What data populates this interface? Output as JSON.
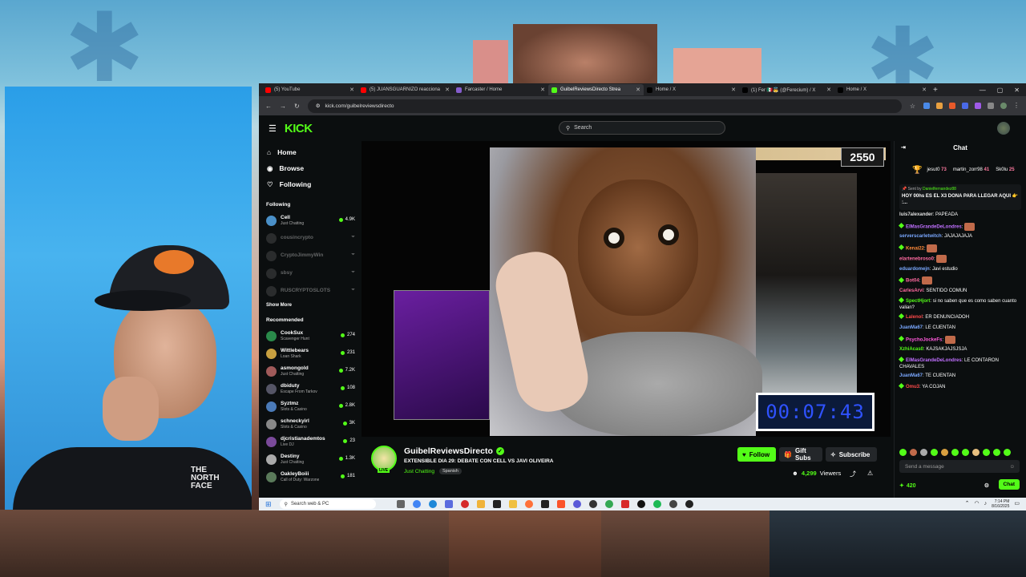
{
  "browser": {
    "tabs": [
      {
        "label": "(5) YouTube",
        "color": "#ff0000",
        "active": false
      },
      {
        "label": "(5) JUANSGUARNIZO reacciona",
        "color": "#ff0000",
        "active": false
      },
      {
        "label": "Farcaster / Home",
        "color": "#855dcd",
        "active": false
      },
      {
        "label": "GuibelReviewsDirecto Strea",
        "color": "#53fc18",
        "active": true
      },
      {
        "label": "Home / X",
        "color": "#000000",
        "active": false
      },
      {
        "label": "(1) Fer 🇲🇽👼 (@Ferecium) / X",
        "color": "#000000",
        "active": false
      },
      {
        "label": "Home / X",
        "color": "#000000",
        "active": false
      }
    ],
    "url": "kick.com/guibelreviewsdirecto"
  },
  "kick": {
    "logo": "KICK",
    "search_placeholder": "Search",
    "nav": [
      {
        "label": "Home",
        "icon": "home-icon",
        "glyph": "⌂"
      },
      {
        "label": "Browse",
        "icon": "compass-icon",
        "glyph": "◉"
      },
      {
        "label": "Following",
        "icon": "heart-icon",
        "glyph": "♡"
      }
    ],
    "following_title": "Following",
    "following": [
      {
        "name": "Cell",
        "category": "Just Chatting",
        "viewers": "4.9K",
        "online": true,
        "color": "#4a90c8"
      },
      {
        "name": "cousincrypto",
        "category": "",
        "viewers": "",
        "online": false,
        "color": "#666"
      },
      {
        "name": "CryptoJimmyWin",
        "category": "",
        "viewers": "",
        "online": false,
        "color": "#666"
      },
      {
        "name": "sbsy",
        "category": "",
        "viewers": "",
        "online": false,
        "color": "#666"
      },
      {
        "name": "RUSCRYPTOSLOTS",
        "category": "",
        "viewers": "",
        "online": false,
        "color": "#666"
      }
    ],
    "show_more": "Show More",
    "recommended_title": "Recommended",
    "recommended": [
      {
        "name": "CookSux",
        "category": "Scavenger Hunt",
        "viewers": "274",
        "color": "#2a8a4a"
      },
      {
        "name": "Wittlebears",
        "category": "Loan Shark",
        "viewers": "231",
        "color": "#c8a040"
      },
      {
        "name": "asmongold",
        "category": "Just Chatting",
        "viewers": "7.2K",
        "color": "#a05a5a"
      },
      {
        "name": "dbiduty",
        "category": "Escape From Tarkov",
        "viewers": "108",
        "color": "#556"
      },
      {
        "name": "Syztmz",
        "category": "Slots & Casino",
        "viewers": "2.8K",
        "color": "#4a7ab8"
      },
      {
        "name": "schneckyirl",
        "category": "Slots & Casino",
        "viewers": "3K",
        "color": "#888"
      },
      {
        "name": "djcristianademtos",
        "category": "Live DJ",
        "viewers": "23",
        "color": "#7a4a9a"
      },
      {
        "name": "Destiny",
        "category": "Just Chatting",
        "viewers": "1.3K",
        "color": "#aaa"
      },
      {
        "name": "OakleyBoiii",
        "category": "Call of Duty: Warzone",
        "viewers": "181",
        "color": "#5a7a5a"
      }
    ]
  },
  "player": {
    "score": "2550",
    "timer": "00:07:43"
  },
  "stream": {
    "live_badge": "LIVE",
    "channel": "GuibelReviewsDirecto",
    "title": "EXTENSIBLE DIA 29: DEBATE CON CELL VS JAVI OLIVEIRA",
    "category": "Just Chatting",
    "language": "Spanish",
    "follow": "Follow",
    "gift_subs": "Gift Subs",
    "subscribe": "Subscribe",
    "viewers_count": "4,299",
    "viewers_label": "Viewers"
  },
  "chat": {
    "title": "Chat",
    "leaderboard": [
      {
        "name": "jesut0",
        "value": "73"
      },
      {
        "name": "martin_zorr98",
        "value": "41"
      },
      {
        "name": "Sk0lu",
        "value": "25"
      }
    ],
    "pinned_by": "Sent by",
    "pinned_user": "Danielfernandez88",
    "pinned_message": "HOY 00hs ES EL X3 DONA PARA LLEGAR AQUI 👉 :...",
    "messages": [
      {
        "user": "luis7alexander",
        "color": "#e0e0e0",
        "text": "PAPEADA",
        "badge": false,
        "emote": false
      },
      {
        "user": "ElMasGrandeDeLondres",
        "color": "#c070ff",
        "text": "",
        "badge": true,
        "emote": true
      },
      {
        "user": "serverscarletwitch",
        "color": "#7aa8ff",
        "text": "JAJAJAJAJA",
        "badge": false,
        "emote": false
      },
      {
        "user": "Kenai22",
        "color": "#ff8a3a",
        "text": "",
        "badge": true,
        "emote": true
      },
      {
        "user": "elartenebroso0",
        "color": "#ff6aa0",
        "text": "",
        "badge": false,
        "emote": true
      },
      {
        "user": "eduardomejn",
        "color": "#7aa8ff",
        "text": "Javi estudio",
        "badge": false,
        "emote": false
      },
      {
        "user": "Bot04",
        "color": "#ff6aa0",
        "text": "",
        "badge": true,
        "emote": true
      },
      {
        "user": "CarlesArvi",
        "color": "#ff6aa0",
        "text": "SENTIDO COMUN",
        "badge": false,
        "emote": false
      },
      {
        "user": "SpectHjort",
        "color": "#53fc18",
        "text": "si no saben que es como saben cuanto valian?",
        "badge": true,
        "emote": false
      },
      {
        "user": "Lalenol",
        "color": "#ff4a4a",
        "text": "ER DENUNCIADOH",
        "badge": true,
        "emote": false
      },
      {
        "user": "JuanMa67",
        "color": "#7aa8ff",
        "text": "LE CUENTAN",
        "badge": false,
        "emote": false
      },
      {
        "user": "PsychoJockeFs",
        "color": "#ff5adc",
        "text": "",
        "badge": true,
        "emote": true
      },
      {
        "user": "XzhiAcas0",
        "color": "#53fc18",
        "text": "KAJSAKJAJSJSJA",
        "badge": false,
        "emote": false
      },
      {
        "user": "ElMasGrandeDeLondres",
        "color": "#c070ff",
        "text": "LE CONTARON CHAVALES",
        "badge": true,
        "emote": false
      },
      {
        "user": "JuanMa67",
        "color": "#7aa8ff",
        "text": "TE CUENTAN",
        "badge": false,
        "emote": false
      },
      {
        "user": "Omu3",
        "color": "#ff4a4a",
        "text": "YA COJAN",
        "badge": true,
        "emote": false
      }
    ],
    "input_placeholder": "Send a message",
    "points": "420",
    "send": "Chat"
  },
  "taskbar": {
    "search_placeholder": "Search web & PC",
    "time": "7:14 PM",
    "date": "8/16/2025"
  },
  "webcam": {
    "jacket_logo": "THE NORTH FACE"
  }
}
